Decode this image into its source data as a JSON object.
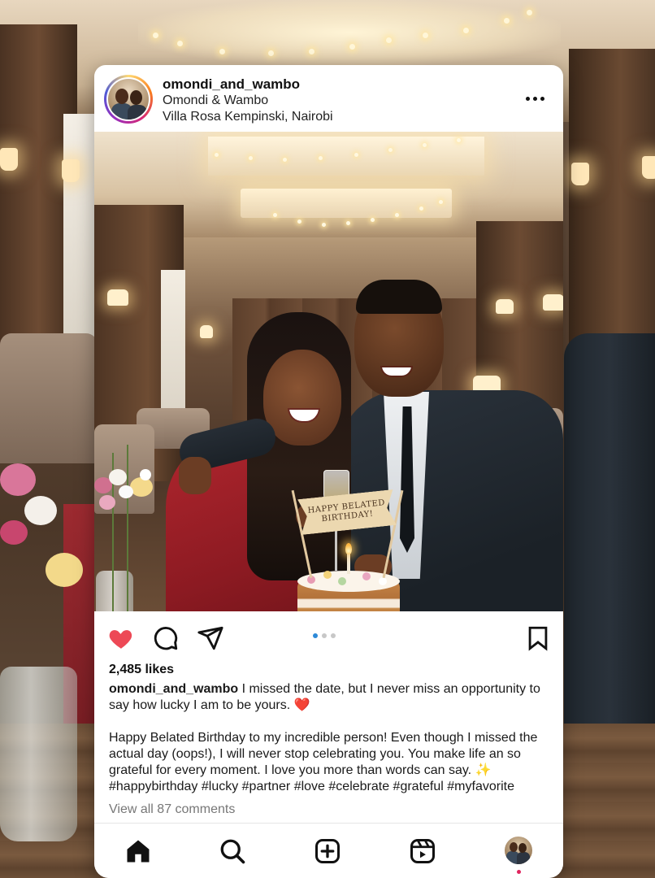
{
  "post": {
    "username": "omondi_and_wambo",
    "display_name": "Omondi & Wambo",
    "location": "Villa Rosa Kempinski, Nairobi",
    "more_icon": "more-horizontal-icon",
    "photo": {
      "banner_line1": "HAPPY BELATED",
      "banner_line2": "BIRTHDAY!"
    },
    "actions": {
      "like_icon": "heart-filled-icon",
      "comment_icon": "comment-icon",
      "share_icon": "send-icon",
      "save_icon": "bookmark-icon",
      "carousel_pages": 3,
      "carousel_active": 1,
      "like_color": "#ed4956",
      "active_dot_color": "#2d8ad8"
    },
    "likes": "2,485 likes",
    "caption": {
      "username": "omondi_and_wambo",
      "first_line": "I missed the date, but I never miss an opportunity to say how lucky I am to be yours. ❤️",
      "body": "Happy Belated Birthday to my incredible person! Even though I missed the actual day (oops!), I will never stop celebrating you. You make life an so grateful for every moment. I love you more than words can say. ✨",
      "hashtags": "#happybirthday #lucky #partner  #love #celebrate #grateful #myfavorite"
    },
    "view_comments": "View all 87 comments"
  },
  "bottom_nav": {
    "items": [
      {
        "name": "home",
        "icon": "home-icon"
      },
      {
        "name": "search",
        "icon": "search-icon"
      },
      {
        "name": "create",
        "icon": "plus-square-icon"
      },
      {
        "name": "reels",
        "icon": "reels-icon"
      },
      {
        "name": "profile",
        "icon": "profile-avatar"
      }
    ],
    "notification_dot_color": "#e0245e"
  }
}
